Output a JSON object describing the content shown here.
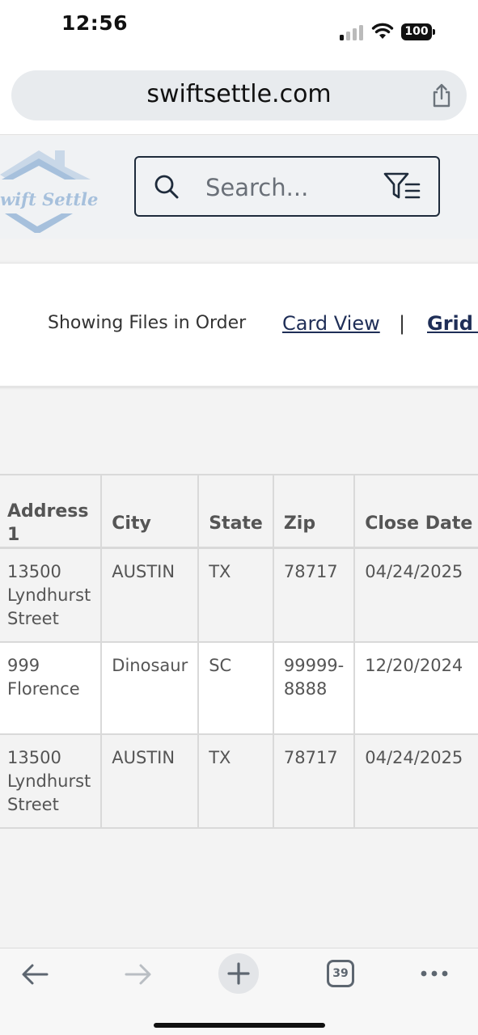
{
  "status_bar": {
    "time": "12:56",
    "battery": "100"
  },
  "browser": {
    "url": "swiftsettle.com",
    "tab_count": "39"
  },
  "header": {
    "logo_text": "wift Settle",
    "search_placeholder": "Search..."
  },
  "view_panel": {
    "showing_label": "Showing Files in Order",
    "card_view_label": "Card View",
    "separator": "|",
    "grid_view_label": "Grid V"
  },
  "table": {
    "columns": [
      "Address 1",
      "City",
      "State",
      "Zip",
      "Close Date"
    ],
    "rows": [
      {
        "address_lines": [
          "13500",
          "Lyndhurst",
          "Street"
        ],
        "city": "AUSTIN",
        "state": "TX",
        "zip_lines": [
          "78717"
        ],
        "close_date": "04/24/2025"
      },
      {
        "address_lines": [
          "999",
          "Florence"
        ],
        "city": "Dinosaur",
        "state": "SC",
        "zip_lines": [
          "99999-",
          "8888"
        ],
        "close_date": "12/20/2024"
      },
      {
        "address_lines": [
          "13500",
          "Lyndhurst",
          "Street"
        ],
        "city": "AUSTIN",
        "state": "TX",
        "zip_lines": [
          "78717"
        ],
        "close_date": "04/24/2025"
      }
    ]
  },
  "colors": {
    "brand_navy": "#1f2e57",
    "logo_blue": "#a6c0dc"
  },
  "icons": [
    "signal-icon",
    "wifi-icon",
    "battery-icon",
    "share-icon",
    "search-icon",
    "filter-icon",
    "back-arrow-icon",
    "forward-arrow-icon",
    "plus-icon",
    "tabs-icon",
    "more-icon"
  ]
}
